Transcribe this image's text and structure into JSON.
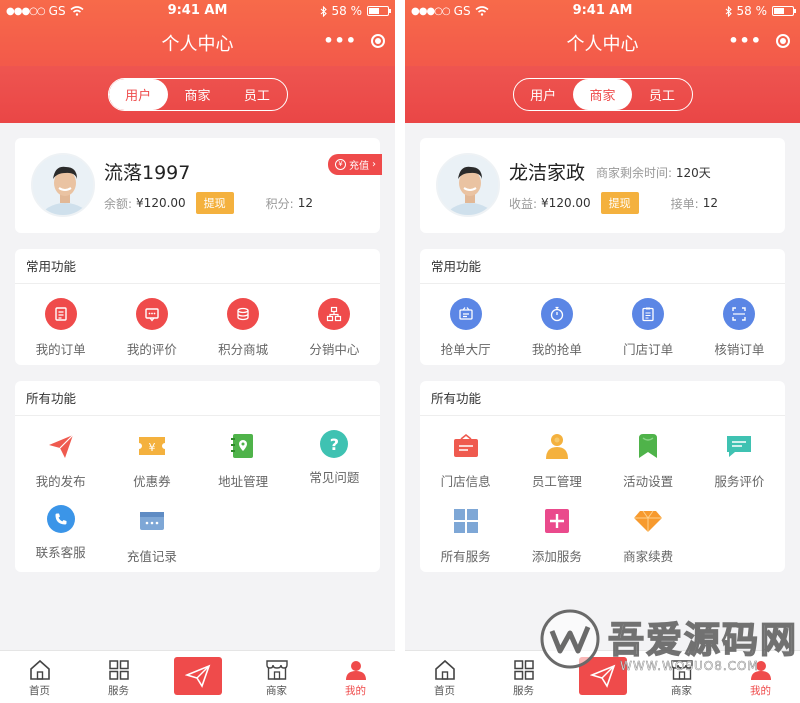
{
  "status": {
    "carrier": "GS",
    "time": "9:41 AM",
    "battery": "58 %",
    "battery_level": 0.58
  },
  "nav": {
    "title": "个人中心"
  },
  "segments": [
    "用户",
    "商家",
    "员工"
  ],
  "user": {
    "name": "流落1997",
    "balance_label": "余额:",
    "balance": "¥120.00",
    "withdraw": "提现",
    "points_label": "积分:",
    "points": "12",
    "recharge": "充值"
  },
  "merchant": {
    "name": "龙洁家政",
    "remain_label": "商家剩余时间:",
    "remain": "120天",
    "income_label": "收益:",
    "income": "¥120.00",
    "withdraw": "提现",
    "orders_label": "接单:",
    "orders": "12"
  },
  "left": {
    "common_title": "常用功能",
    "common": [
      {
        "label": "我的订单",
        "icon": "order-icon"
      },
      {
        "label": "我的评价",
        "icon": "comment-icon"
      },
      {
        "label": "积分商城",
        "icon": "points-icon"
      },
      {
        "label": "分销中心",
        "icon": "distribution-icon"
      }
    ],
    "all_title": "所有功能",
    "all": [
      {
        "label": "我的发布",
        "icon": "paper-plane-icon"
      },
      {
        "label": "优惠券",
        "icon": "coupon-icon"
      },
      {
        "label": "地址管理",
        "icon": "address-book-icon"
      },
      {
        "label": "常见问题",
        "icon": "question-icon"
      },
      {
        "label": "联系客服",
        "icon": "phone-icon"
      },
      {
        "label": "充值记录",
        "icon": "wallet-icon"
      }
    ]
  },
  "right": {
    "common_title": "常用功能",
    "common": [
      {
        "label": "抢单大厅",
        "icon": "hall-icon"
      },
      {
        "label": "我的抢单",
        "icon": "stopwatch-icon"
      },
      {
        "label": "门店订单",
        "icon": "clipboard-icon"
      },
      {
        "label": "核销订单",
        "icon": "scan-icon"
      }
    ],
    "all_title": "所有功能",
    "all": [
      {
        "label": "门店信息",
        "icon": "store-icon"
      },
      {
        "label": "员工管理",
        "icon": "staff-icon"
      },
      {
        "label": "活动设置",
        "icon": "bookmark-icon"
      },
      {
        "label": "服务评价",
        "icon": "message-icon"
      },
      {
        "label": "所有服务",
        "icon": "grid-icon"
      },
      {
        "label": "添加服务",
        "icon": "plus-icon"
      },
      {
        "label": "商家续费",
        "icon": "diamond-icon"
      }
    ]
  },
  "tabbar": [
    {
      "label": "首页",
      "icon": "home-icon"
    },
    {
      "label": "服务",
      "icon": "grid-outline-icon"
    },
    {
      "label": "",
      "icon": "send-icon"
    },
    {
      "label": "商家",
      "icon": "shop-icon"
    },
    {
      "label": "我的",
      "icon": "user-icon"
    }
  ],
  "watermark": {
    "text": "吾爱源码网",
    "url": "WWW.WOSUO8.COM"
  },
  "colors": {
    "primary": "#ef4b4b",
    "gold": "#f4b13e",
    "blue": "#5b86e5"
  }
}
